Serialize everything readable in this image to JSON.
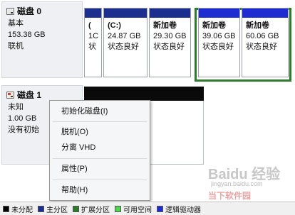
{
  "disks": [
    {
      "name": "磁盘 0",
      "type": "基本",
      "size": "153.38 GB",
      "status": "联机"
    },
    {
      "name": "磁盘 1",
      "type": "未知",
      "size": "1.00 GB",
      "status": "没有初始"
    }
  ],
  "partitions": [
    {
      "label": "(",
      "size": "1C",
      "status": "状"
    },
    {
      "label": "(C:)",
      "size": "24.87 GB",
      "status": "状态良好"
    },
    {
      "label": "新加卷",
      "size": "29.30 GB",
      "status": "状态良好"
    },
    {
      "label": "新加卷",
      "size": "",
      "status": ""
    },
    {
      "label": "新加卷",
      "size": "39.06 GB",
      "status": "状态良好"
    },
    {
      "label": "新加卷",
      "size": "60.06 GB",
      "status": "状态良好"
    }
  ],
  "context_menu": {
    "init": "初始化磁盘(I)",
    "offline": "脱机(O)",
    "detach_vhd": "分离 VHD",
    "properties": "属性(P)",
    "help": "帮助(H)"
  },
  "legend": [
    {
      "label": "未分配",
      "color": "#000000"
    },
    {
      "label": "主分区",
      "color": "#1d2f8e"
    },
    {
      "label": "扩展分区",
      "color": "#2c7a2c"
    },
    {
      "label": "可用空间",
      "color": "#4fd64f"
    },
    {
      "label": "逻辑驱动器",
      "color": "#1f2ccf"
    }
  ],
  "watermark": {
    "brand": "Baidu 经验",
    "url": "jingyan.baidu.com",
    "site": "当下软件园"
  }
}
